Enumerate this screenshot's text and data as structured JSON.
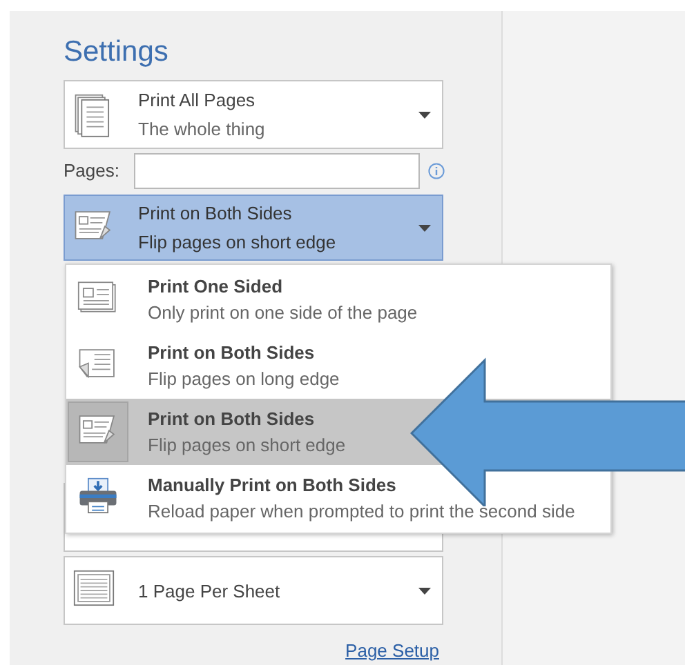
{
  "settings": {
    "title": "Settings",
    "print_range": {
      "title": "Print All Pages",
      "subtitle": "The whole thing"
    },
    "pages": {
      "label": "Pages:"
    },
    "duplex": {
      "title": "Print on Both Sides",
      "subtitle": "Flip pages on short edge",
      "expanded": true
    },
    "duplex_menu": [
      {
        "kind": "one-sided",
        "title": "Print One Sided",
        "subtitle": "Only print on one side of the page",
        "selected": false
      },
      {
        "kind": "long-edge",
        "title": "Print on Both Sides",
        "subtitle": "Flip pages on long edge",
        "selected": false
      },
      {
        "kind": "short-edge",
        "title": "Print on Both Sides",
        "subtitle": "Flip pages on short edge",
        "selected": true
      },
      {
        "kind": "manual",
        "title": "Manually Print on Both Sides",
        "subtitle": "Reload paper when prompted to print the second side",
        "selected": false
      }
    ],
    "pages_per_sheet": {
      "title": "1 Page Per Sheet"
    },
    "page_setup_link": "Page Setup"
  }
}
